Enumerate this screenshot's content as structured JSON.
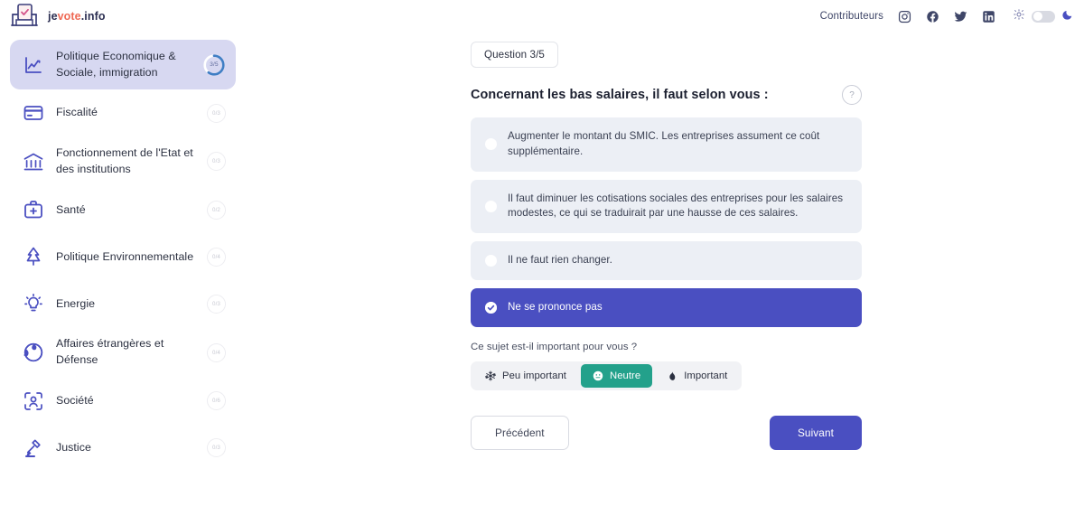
{
  "header": {
    "brand": {
      "part1": "je",
      "part2": "vote",
      "part3": ".info",
      "logo_icon": "ballot-box-icon"
    },
    "contributors_label": "Contributeurs",
    "social": [
      {
        "name": "instagram-icon"
      },
      {
        "name": "facebook-icon"
      },
      {
        "name": "twitter-icon"
      },
      {
        "name": "linkedin-icon"
      }
    ],
    "theme": {
      "sun_icon": "sun-icon",
      "moon_icon": "moon-icon",
      "toggle_state": "off"
    }
  },
  "sidebar": {
    "items": [
      {
        "label": "Politique Economique & Sociale, immigration",
        "badge": "3/5",
        "icon": "chart-line-icon",
        "active": true,
        "progress": 60
      },
      {
        "label": "Fiscalité",
        "badge": "0/3",
        "icon": "credit-card-icon",
        "active": false
      },
      {
        "label": "Fonctionnement de l'Etat et des institutions",
        "badge": "0/3",
        "icon": "bank-icon",
        "active": false
      },
      {
        "label": "Santé",
        "badge": "0/2",
        "icon": "medical-kit-icon",
        "active": false
      },
      {
        "label": "Politique Environnementale",
        "badge": "0/4",
        "icon": "tree-icon",
        "active": false
      },
      {
        "label": "Energie",
        "badge": "0/3",
        "icon": "lightbulb-icon",
        "active": false
      },
      {
        "label": "Affaires étrangères et Défense",
        "badge": "0/4",
        "icon": "globe-icon",
        "active": false
      },
      {
        "label": "Société",
        "badge": "0/6",
        "icon": "person-frame-icon",
        "active": false
      },
      {
        "label": "Justice",
        "badge": "0/3",
        "icon": "gavel-icon",
        "active": false
      }
    ]
  },
  "main": {
    "question_counter": "Question 3/5",
    "question_title": "Concernant les bas salaires, il faut selon vous :",
    "help_icon": "question-mark-circle-icon",
    "options": [
      {
        "text": "Augmenter le montant du SMIC. Les entreprises assument ce coût supplémentaire.",
        "selected": false
      },
      {
        "text": "Il faut diminuer les cotisations sociales des entreprises pour les salaires modestes, ce qui se traduirait par une hausse de ces salaires.",
        "selected": false
      },
      {
        "text": "Il ne faut rien changer.",
        "selected": false
      },
      {
        "text": "Ne se prononce pas",
        "selected": true
      }
    ],
    "importance_question": "Ce sujet est-il important pour vous ?",
    "importance_options": [
      {
        "label": "Peu important",
        "icon": "snowflake-icon",
        "selected": false
      },
      {
        "label": "Neutre",
        "icon": "neutral-face-icon",
        "selected": true
      },
      {
        "label": "Important",
        "icon": "flame-icon",
        "selected": false
      }
    ],
    "prev_label": "Précédent",
    "next_label": "Suivant"
  },
  "colors": {
    "accent_indigo": "#4a4fc1",
    "accent_teal": "#23a18b",
    "active_sidebar_bg": "#d7d8f1",
    "option_bg": "#eceff5",
    "brand_orange": "#ef6a55"
  }
}
